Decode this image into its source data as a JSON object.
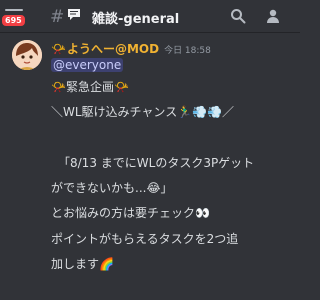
{
  "header": {
    "unread_count": "695",
    "channel_name": "雑談-general"
  },
  "message": {
    "role_icon": "📯",
    "author": "ようへー@MOD",
    "timestamp": "今日 18:58",
    "mention": "@everyone",
    "lines": [
      "📯緊急企画📯",
      "＼WL駆け込みチャンス🏃‍♂️💨💨／",
      "",
      "「8/13 までにWLのタスク3Pゲット",
      "ができないかも...😂」",
      "とお悩みの方は要チェック👀",
      "ポイントがもらえるタスクを2つ追",
      "加します🌈"
    ]
  },
  "colors": {
    "background": "#313338",
    "author": "#f0b232",
    "mention_bg": "#3c4270",
    "badge": "#f23f43"
  }
}
